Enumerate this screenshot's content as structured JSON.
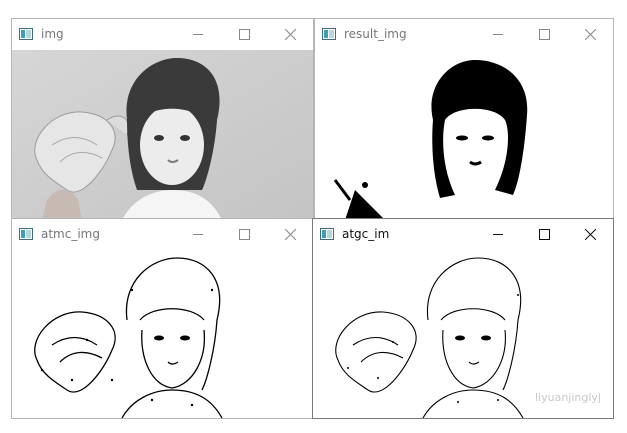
{
  "windows": [
    {
      "title": "img"
    },
    {
      "title": "result_img"
    },
    {
      "title": "atmc_img"
    },
    {
      "title": "atgc_im"
    }
  ],
  "watermark": "liyuanjinglyj"
}
